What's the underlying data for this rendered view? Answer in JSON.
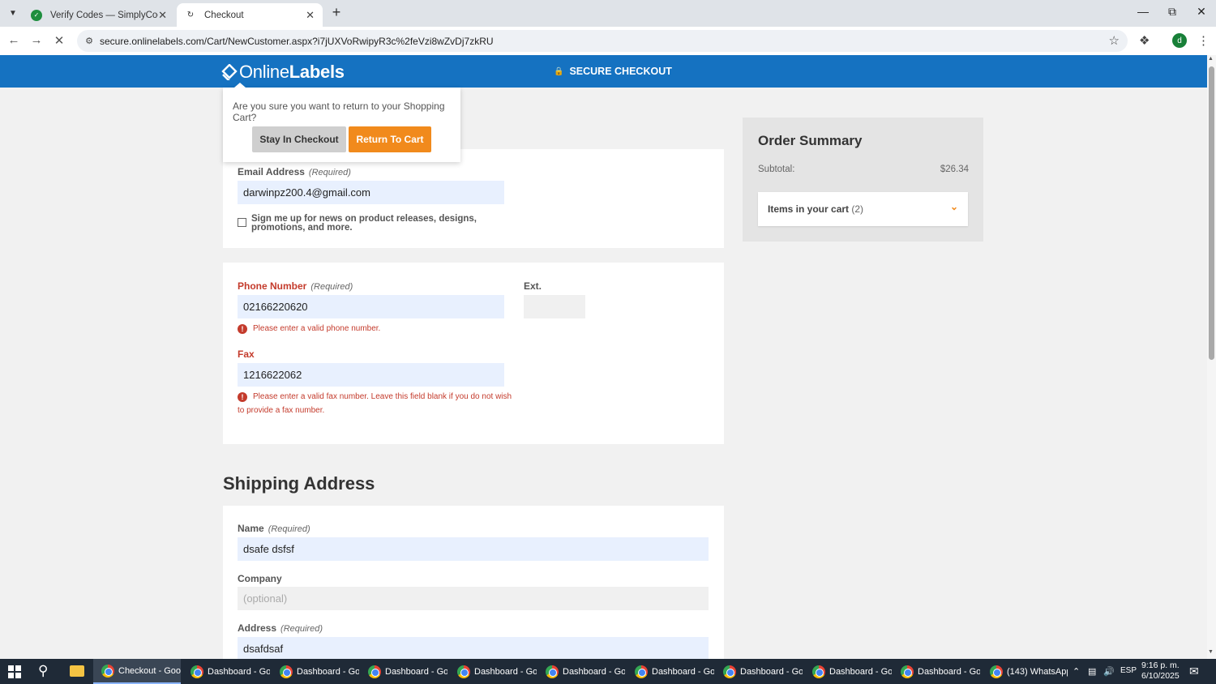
{
  "browser": {
    "tabs": [
      {
        "title": "Verify Codes — SimplyCodes",
        "active": false
      },
      {
        "title": "Checkout",
        "active": true
      }
    ],
    "url": "secure.onlinelabels.com/Cart/NewCustomer.aspx?i7jUXVoRwipyR3c%2feVzi8wZvDj7zkRU",
    "profile_initial": "d"
  },
  "header": {
    "logo_online": "Online",
    "logo_labels": "Labels",
    "secure_checkout": "SECURE CHECKOUT",
    "brand_color": "#1572c1"
  },
  "popup": {
    "message": "Are you sure you want to return to your Shopping Cart?",
    "stay_label": "Stay In Checkout",
    "return_label": "Return To Cart"
  },
  "contact": {
    "email_label": "Email Address",
    "email_required": "(Required)",
    "email_value": "darwinpz200.4@gmail.com",
    "newsletter_label": "Sign me up for news on product releases, designs, promotions, and more."
  },
  "phone": {
    "phone_label": "Phone Number",
    "phone_required": "(Required)",
    "phone_value": "02166220620",
    "phone_error": "Please enter a valid phone number.",
    "ext_label": "Ext.",
    "fax_label": "Fax",
    "fax_value": "1216622062",
    "fax_error": "Please enter a valid fax number. Leave this field blank if you do not wish to provide a fax number."
  },
  "shipping": {
    "title": "Shipping Address",
    "name_label": "Name",
    "name_required": "(Required)",
    "name_value": "dsafe dsfsf",
    "company_label": "Company",
    "company_placeholder": "(optional)",
    "address_label": "Address",
    "address_required": "(Required)",
    "address_value": "dsafdsaf"
  },
  "summary": {
    "title": "Order Summary",
    "subtotal_label": "Subtotal:",
    "subtotal_value": "$26.34",
    "items_label": "Items in your cart",
    "items_count": "(2)"
  },
  "taskbar": {
    "items": [
      "Checkout - Goo...",
      "Dashboard - Go...",
      "Dashboard - Go...",
      "Dashboard - Go...",
      "Dashboard - Go...",
      "Dashboard - Go...",
      "Dashboard - Go...",
      "Dashboard - Go...",
      "Dashboard - Go...",
      "Dashboard - Go...",
      "(143) WhatsApp..."
    ],
    "language": "ESP",
    "time": "9:16 p. m.",
    "date": "6/10/2025"
  }
}
